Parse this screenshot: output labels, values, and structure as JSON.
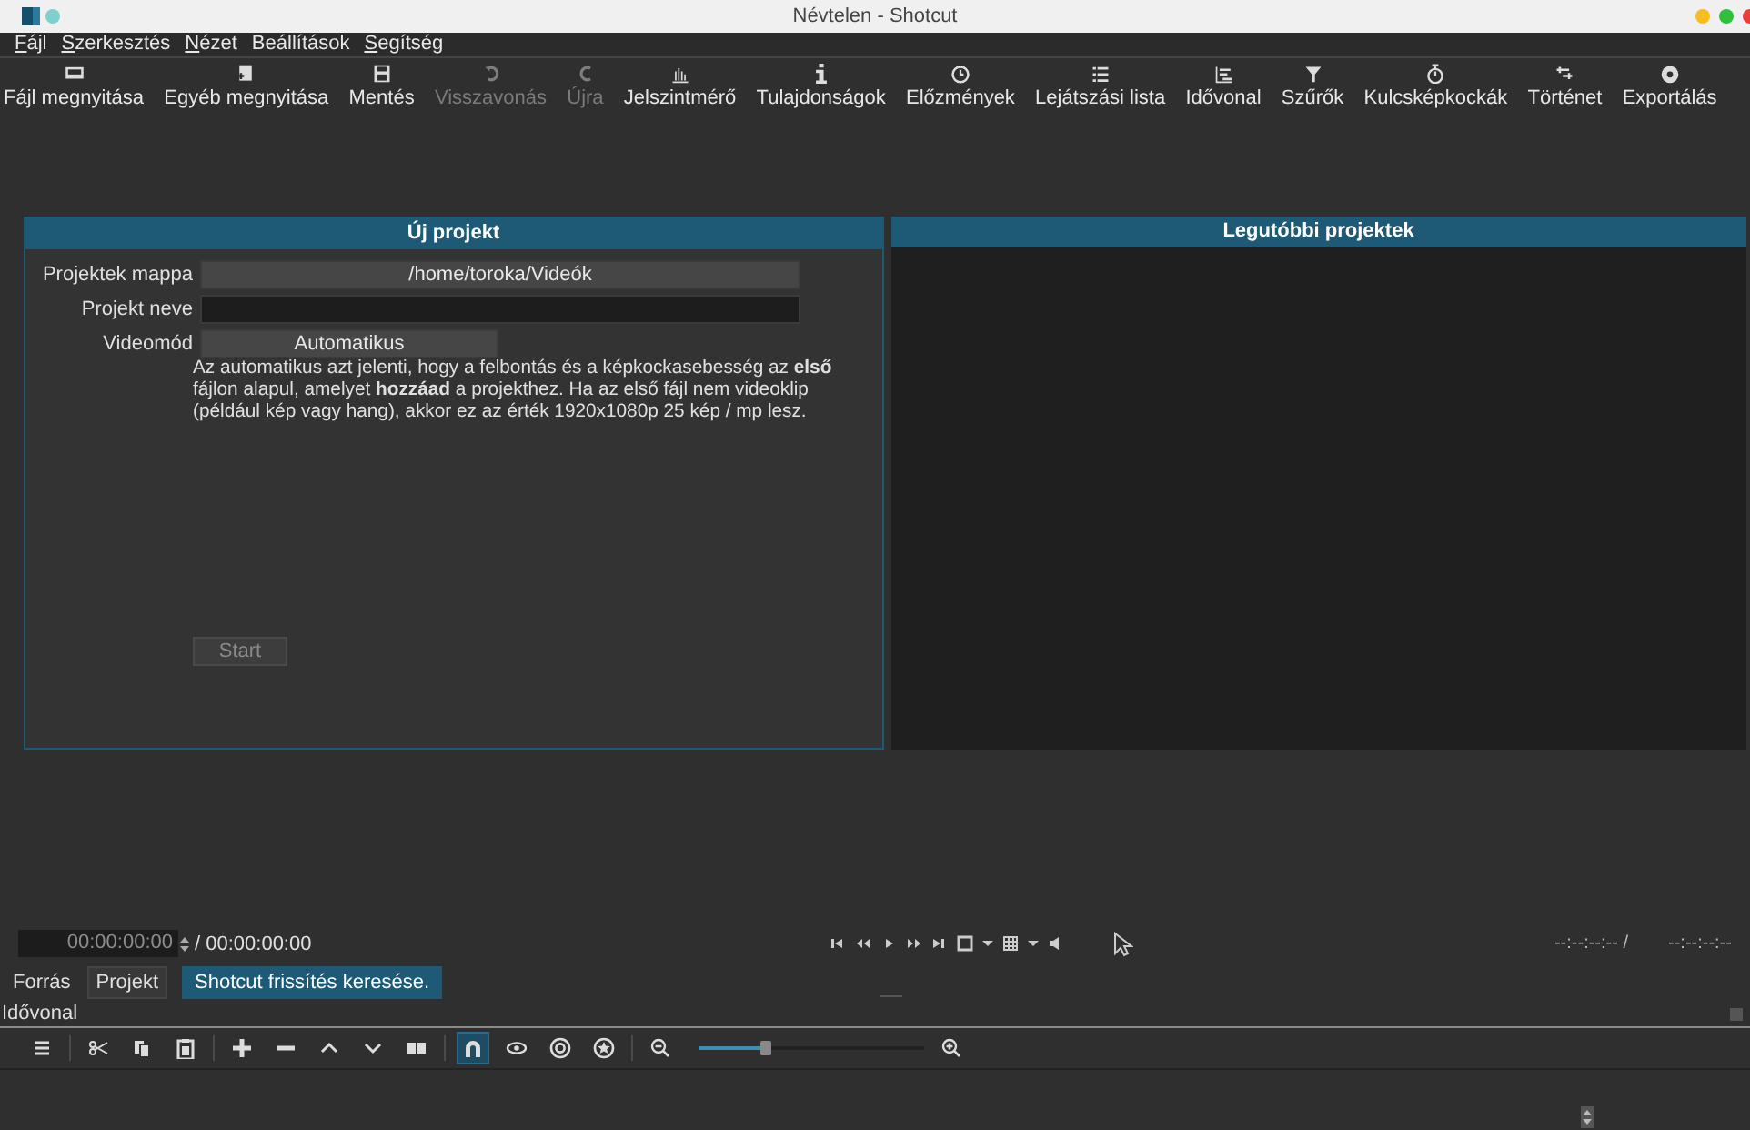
{
  "window": {
    "title": "Névtelen - Shotcut"
  },
  "menu": [
    {
      "label": "Fájl",
      "mnemonic": true
    },
    {
      "label": "Szerkesztés",
      "mnemonic": true
    },
    {
      "label": "Nézet",
      "mnemonic": true
    },
    {
      "label": "Beállítások",
      "mnemonic": false
    },
    {
      "label": "Segítség",
      "mnemonic": true
    }
  ],
  "toolbar": [
    {
      "label": "Fájl megnyitása",
      "disabled": false
    },
    {
      "label": "Egyéb megnyitása",
      "disabled": false
    },
    {
      "label": "Mentés",
      "disabled": false
    },
    {
      "label": "Visszavonás",
      "disabled": true
    },
    {
      "label": "Újra",
      "disabled": true
    },
    {
      "label": "Jelszintmérő",
      "disabled": false
    },
    {
      "label": "Tulajdonságok",
      "disabled": false
    },
    {
      "label": "Előzmények",
      "disabled": false
    },
    {
      "label": "Lejátszási lista",
      "disabled": false
    },
    {
      "label": "Idővonal",
      "disabled": false
    },
    {
      "label": "Szűrők",
      "disabled": false
    },
    {
      "label": "Kulcsképkockák",
      "disabled": false
    },
    {
      "label": "Történet",
      "disabled": false
    },
    {
      "label": "Exportálás",
      "disabled": false
    }
  ],
  "new_project": {
    "title": "Új projekt",
    "fields": [
      {
        "label": "Projektek mappa",
        "kind": "button",
        "value": "/home/toroka/Videók"
      },
      {
        "label": "Projekt neve",
        "kind": "text"
      },
      {
        "label": "Videomód",
        "kind": "dropdown",
        "value": "Automatikus"
      }
    ],
    "description": "Az automatikus azt jelenti, hogy a felbontás és a képkockasebesség az **első** fájlon alapul, amelyet **hozzáad** a projekthez. Ha az első fájl nem videoklip (például kép vagy hang), akkor ez az érték 1920x1080p 25 kép / mp lesz.",
    "start_button": {
      "label": "Start",
      "disabled": true
    }
  },
  "recent_projects": {
    "title": "Legutóbbi projektek"
  },
  "player": {
    "position": "00:00:00:00",
    "duration": "/ 00:00:00:00",
    "in_point": "--:--:--:-- /",
    "out_point": "--:--:--:--"
  },
  "tabs": [
    {
      "label": "Forrás",
      "selected": false
    },
    {
      "label": "Projekt",
      "selected": true
    }
  ],
  "status_message": "Shotcut frissítés keresése.",
  "timeline": {
    "title": "Idővonal",
    "tools": [
      {
        "kind": "menu",
        "on": false
      },
      {
        "kind": "cut",
        "on": false
      },
      {
        "kind": "copy",
        "on": false
      },
      {
        "kind": "paste",
        "on": false
      },
      {
        "kind": "append",
        "on": false
      },
      {
        "kind": "remove",
        "on": false
      },
      {
        "kind": "lift",
        "on": false
      },
      {
        "kind": "overwrite",
        "on": false
      },
      {
        "kind": "split",
        "on": false
      },
      {
        "kind": "snap",
        "on": true
      },
      {
        "kind": "scrub",
        "on": false
      },
      {
        "kind": "ripple",
        "on": false
      },
      {
        "kind": "ripple-all",
        "on": false
      },
      {
        "kind": "zoom-out",
        "on": false
      }
    ],
    "zoom": {
      "level": 0.3
    }
  }
}
